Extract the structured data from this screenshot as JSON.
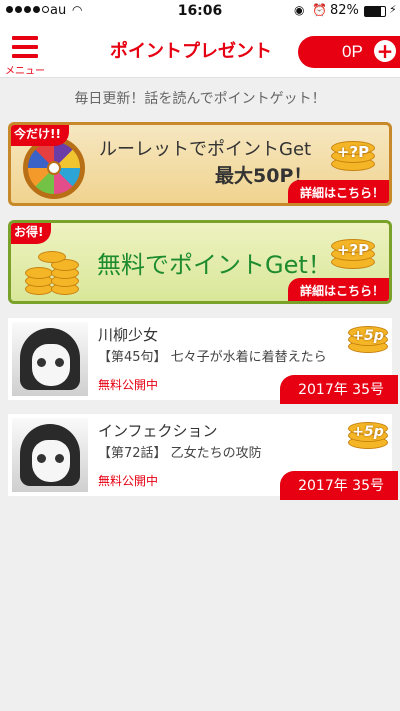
{
  "status_bar": {
    "carrier": "au",
    "time": "16:06",
    "battery": "82%",
    "battery_level": 0.82
  },
  "header": {
    "menu_label": "メニュー",
    "title": "ポイントプレゼント",
    "points": "0P",
    "plus_symbol": "+"
  },
  "tagline": "毎日更新！話を読んでポイントゲット！",
  "banners": [
    {
      "corner": "今だけ!!",
      "line1": "ルーレットでポイントGet",
      "line2": "最大50P！",
      "coin_text": "+?P",
      "detail": "詳細はこちら！"
    },
    {
      "corner": "お得!",
      "line1": "無料でポイントGet！",
      "coin_text": "+?P",
      "detail": "詳細はこちら！"
    }
  ],
  "items": [
    {
      "title": "川柳少女",
      "episode": "【第45句】 七々子が水着に着替えたら",
      "status": "無料公開中",
      "issue": "2017年 35号",
      "bonus": "+5p"
    },
    {
      "title": "インフェクション",
      "episode": "【第72話】 乙女たちの攻防",
      "status": "無料公開中",
      "issue": "2017年 35号",
      "bonus": "+5p"
    }
  ],
  "colors": {
    "accent": "#e60012",
    "coin": "#f4b626"
  }
}
